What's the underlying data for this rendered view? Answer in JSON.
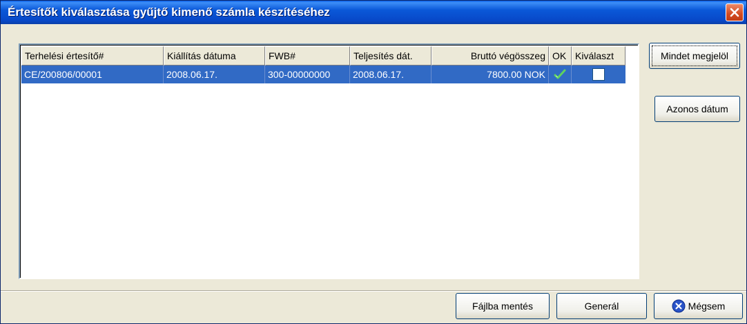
{
  "window": {
    "title": "Értesítők kiválasztása gyűjtő kimenő számla készítéséhez"
  },
  "table": {
    "columns": [
      "Terhelési értesítő#",
      "Kiállítás dátuma",
      "FWB#",
      "Teljesítés dát.",
      "Bruttó végösszeg",
      "OK",
      "Kiválaszt"
    ],
    "rows": [
      {
        "ertesito": "CE/200806/00001",
        "kiallitas": "2008.06.17.",
        "fwb": "300-00000000",
        "teljesites": "2008.06.17.",
        "brutto": "7800.00 NOK",
        "ok_icon": "checkmark-icon",
        "kivalaszt_checked": false,
        "selected": true
      }
    ]
  },
  "side_buttons": {
    "select_all": "Mindet megjelöl",
    "same_date": "Azonos dátum"
  },
  "bottom_buttons": {
    "save_to_file": "Fájlba mentés",
    "generate": "Generál",
    "cancel": "Mégsem",
    "cancel_icon": "x-circle-icon"
  },
  "colors": {
    "selection": "#316ac5",
    "titlebar": "#0a58d8",
    "dialog_bg": "#ece9d8"
  }
}
